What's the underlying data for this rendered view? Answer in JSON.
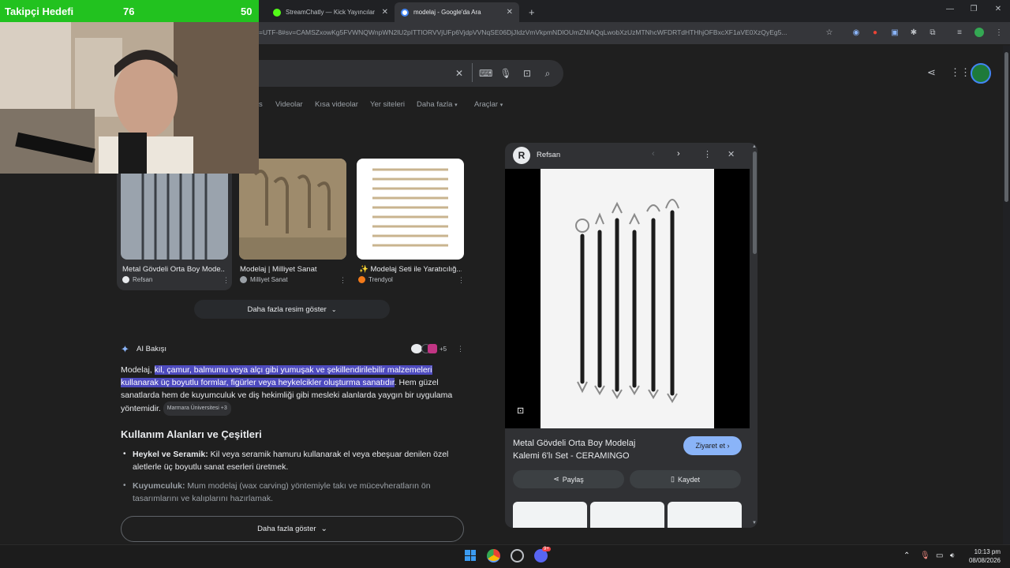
{
  "browser": {
    "tabs": [
      {
        "title": "StreamChatly — Kick Yayıncılar",
        "active": false
      },
      {
        "title": "modelaj - Google'da Ara",
        "active": true
      }
    ],
    "url": "=UTF-8#sv=CAMSZxowKg5FVWNQWnpWN2lU2pITTlORVVjUFp6VjdpVVNqSE06DjJIdzVmVkpmNDlOUmZNIAQqLwobXzUzMTNhcWFDRTdHTHhjOFBxcXF1aVE0XzQyEg5..."
  },
  "overlay": {
    "follow_label": "Takipçi Hedefi",
    "follow_current": "76",
    "follow_goal": "50"
  },
  "search": {
    "nav_tabs": [
      "s",
      "Videolar",
      "Kısa videolar",
      "Yer siteleri",
      "Daha fazla",
      "Araçlar"
    ]
  },
  "images": [
    {
      "caption": "Metal Gövdeli Orta Boy Mode...",
      "source": "Refsan"
    },
    {
      "caption": "Modelaj | Milliyet Sanat",
      "source": "Milliyet Sanat"
    },
    {
      "caption": "Modelaj Seti ile Yaratıcılığ...",
      "source": "Trendyol"
    }
  ],
  "more_images_label": "Daha fazla resim göster",
  "ai": {
    "title": "AI Bakışı",
    "plus_count": "+5",
    "p1_start": "Modelaj,",
    "p1_highlight": "kil, çamur, balmumu veya alçı gibi yumuşak ve şekillendirilebilir malzemeleri kullanarak üç boyutlu formlar, figürler veya heykelcikler oluşturma sanatıdır",
    "p1_end": ". Hem güzel sanatlarda hem de kuyumculuk ve diş hekimliği gibi mesleki alanlarda yaygın bir uygulama yöntemidir.",
    "p1_chip": "Marmara Üniversitesi +3",
    "section_title": "Kullanım Alanları ve Çeşitleri",
    "bullet1_bold": "Heykel ve Seramik:",
    "bullet1_text": " Kil veya seramik hamuru kullanarak el veya ebeşuar denilen özel aletlerle üç boyutlu sanat eserleri üretmek.",
    "bullet2_bold": "Kuyumculuk:",
    "bullet2_text": " Mum modelaj (wax carving) yöntemiyle takı ve mücevheratların ön tasarımlarını ve kalıplarını hazırlamak.",
    "more_label": "Daha fazla göster"
  },
  "panel": {
    "source": "Refsan",
    "title_line1": "Metal Gövdeli Orta Boy Modelaj",
    "title_line2": "Kalemi 6'lı Set - CERAMINGO",
    "visit_label": "Ziyaret et",
    "share_label": "Paylaş",
    "save_label": "Kaydet"
  },
  "taskbar": {
    "time": "10:13 pm",
    "date": "08/08/2026",
    "discord_badge": "9+"
  }
}
